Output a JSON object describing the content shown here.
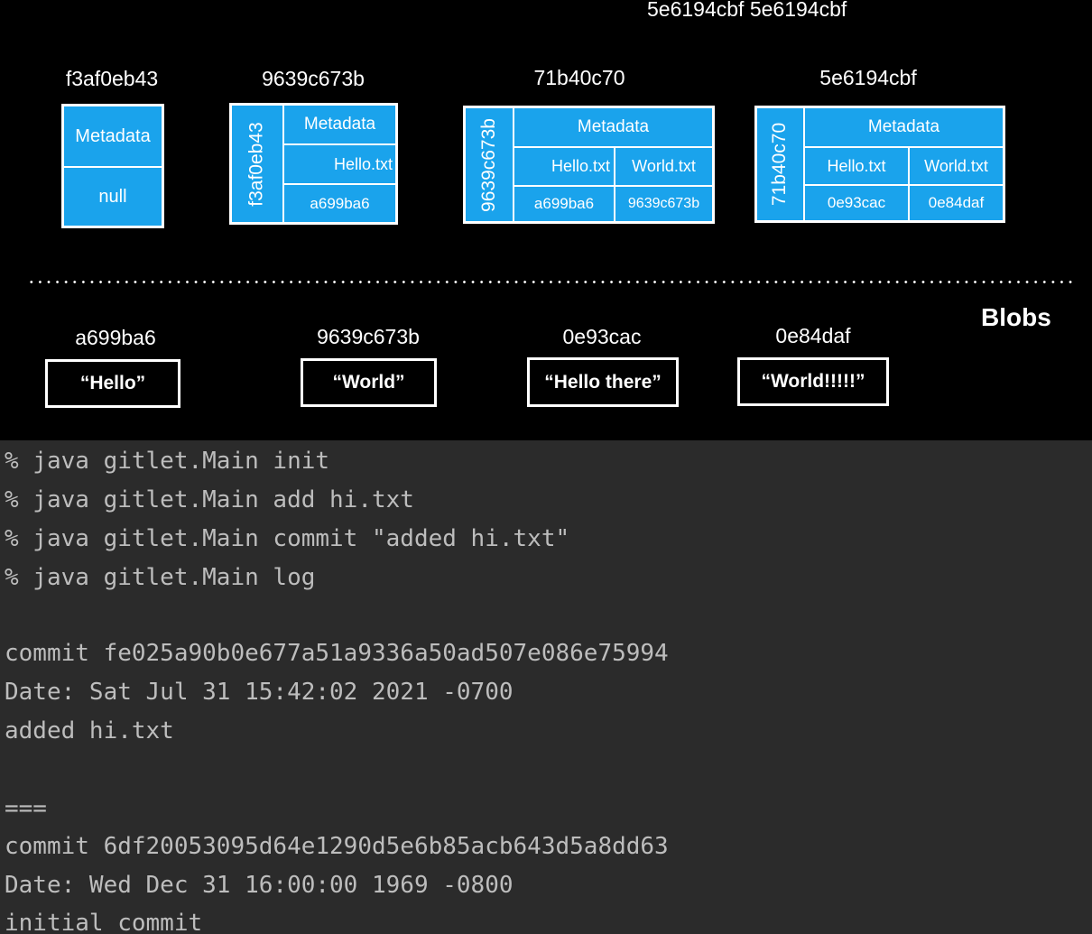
{
  "diagram": {
    "top_hashes": "5e6194cbf  5e6194cbf",
    "commits": [
      {
        "hash": "f3af0eb43",
        "metadata": "Metadata",
        "value": "null"
      },
      {
        "hash": "9639c673b",
        "parent": "f3af0eb43",
        "metadata": "Metadata",
        "files": [
          "Hello.txt"
        ],
        "blobs": [
          "a699ba6"
        ]
      },
      {
        "hash": "71b40c70",
        "parent": "9639c673b",
        "metadata": "Metadata",
        "files": [
          "Hello.txt",
          "World.txt"
        ],
        "blobs": [
          "a699ba6",
          "9639c673b"
        ]
      },
      {
        "hash": "5e6194cbf",
        "parent": "71b40c70",
        "metadata": "Metadata",
        "files": [
          "Hello.txt",
          "World.txt"
        ],
        "blobs": [
          "0e93cac",
          "0e84daf"
        ]
      }
    ],
    "blobs_title": "Blobs",
    "blobs": [
      {
        "hash": "a699ba6",
        "content": "“Hello”"
      },
      {
        "hash": "9639c673b",
        "content": "“World”"
      },
      {
        "hash": "0e93cac",
        "content": "“Hello there”"
      },
      {
        "hash": "0e84daf",
        "content": "“World!!!!!”"
      }
    ]
  },
  "terminal": {
    "lines": [
      "% java gitlet.Main init",
      "% java gitlet.Main add hi.txt",
      "% java gitlet.Main commit \"added hi.txt\"",
      "% java gitlet.Main log",
      "",
      "commit fe025a90b0e677a51a9336a50ad507e086e75994",
      "Date: Sat Jul 31 15:42:02 2021 -0700",
      "added hi.txt",
      "",
      "===",
      "commit 6df20053095d64e1290d5e6b85acb643d5a8dd63",
      "Date: Wed Dec 31 16:00:00 1969 -0800",
      "initial commit"
    ]
  }
}
